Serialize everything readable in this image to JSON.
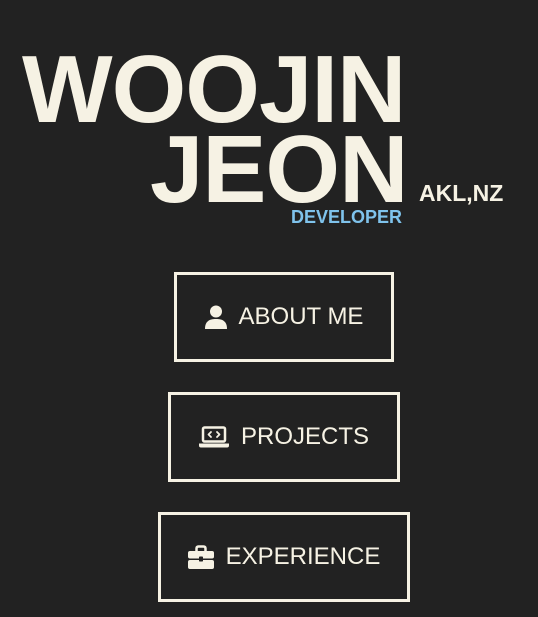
{
  "header": {
    "first_name": "WOOJIN",
    "last_name": "JEON",
    "location": "AKL,NZ",
    "role": "DEVELOPER"
  },
  "nav": {
    "items": [
      {
        "label": "ABOUT ME",
        "icon": "person-icon"
      },
      {
        "label": "PROJECTS",
        "icon": "laptop-code-icon"
      },
      {
        "label": "EXPERIENCE",
        "icon": "briefcase-icon"
      }
    ]
  },
  "colors": {
    "background": "#222222",
    "foreground": "#f6f2e4",
    "accent": "#7fc3ec"
  }
}
